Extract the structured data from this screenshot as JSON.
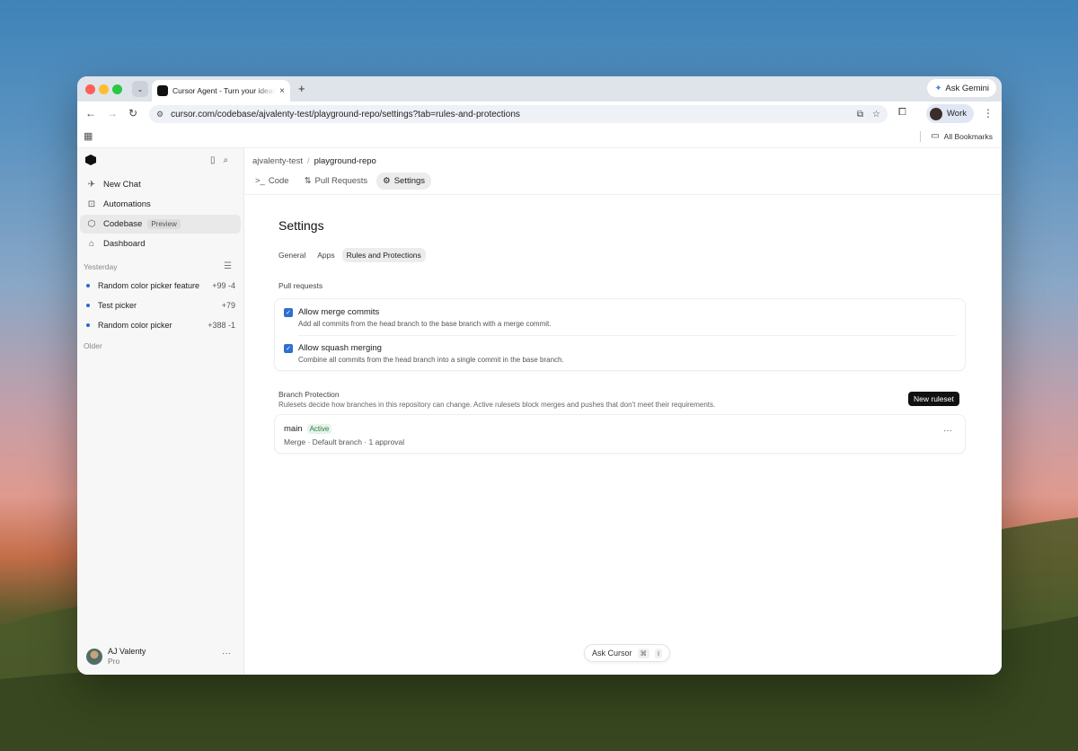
{
  "browser": {
    "tab_title": "Cursor Agent - Turn your ideas into code",
    "tab_close": "×",
    "new_tab": "+",
    "url": "cursor.com/codebase/ajvalenty-test/playground-repo/settings?tab=rules-and-protections",
    "ask_gemini": "Ask Gemini",
    "profile": "Work",
    "all_bookmarks": "All Bookmarks"
  },
  "sidebar": {
    "nav": [
      {
        "label": "New Chat"
      },
      {
        "label": "Automations"
      },
      {
        "label": "Codebase",
        "badge": "Preview"
      },
      {
        "label": "Dashboard"
      }
    ],
    "section_yesterday": "Yesterday",
    "chats": [
      {
        "title": "Random color picker feature",
        "diff": "+99 -4"
      },
      {
        "title": "Test picker",
        "diff": "+79"
      },
      {
        "title": "Random color picker",
        "diff": "+388 -1"
      }
    ],
    "section_older": "Older",
    "user": {
      "name": "AJ Valenty",
      "plan": "Pro",
      "more": "···"
    }
  },
  "main": {
    "breadcrumb": {
      "org": "ajvalenty-test",
      "sep": "/",
      "repo": "playground-repo"
    },
    "repo_tabs": [
      {
        "icon": ">_",
        "label": "Code"
      },
      {
        "icon": "⇅",
        "label": "Pull Requests"
      },
      {
        "icon": "⚙",
        "label": "Settings"
      }
    ],
    "title": "Settings",
    "subtabs": [
      "General",
      "Apps",
      "Rules and Protections"
    ],
    "pull_requests": {
      "label": "Pull requests",
      "options": [
        {
          "title": "Allow merge commits",
          "desc": "Add all commits from the head branch to the base branch with a merge commit."
        },
        {
          "title": "Allow squash merging",
          "desc": "Combine all commits from the head branch into a single commit in the base branch."
        }
      ]
    },
    "branch_protection": {
      "title": "Branch Protection",
      "desc": "Rulesets decide how branches in this repository can change. Active rulesets block merges and pushes that don't meet their requirements.",
      "new_button": "New ruleset",
      "rule": {
        "name": "main",
        "status": "Active",
        "meta": "Merge · Default branch · 1 approval",
        "more": "···"
      }
    },
    "ask_cursor": {
      "label": "Ask Cursor",
      "key1": "⌘",
      "key2": "I"
    }
  }
}
